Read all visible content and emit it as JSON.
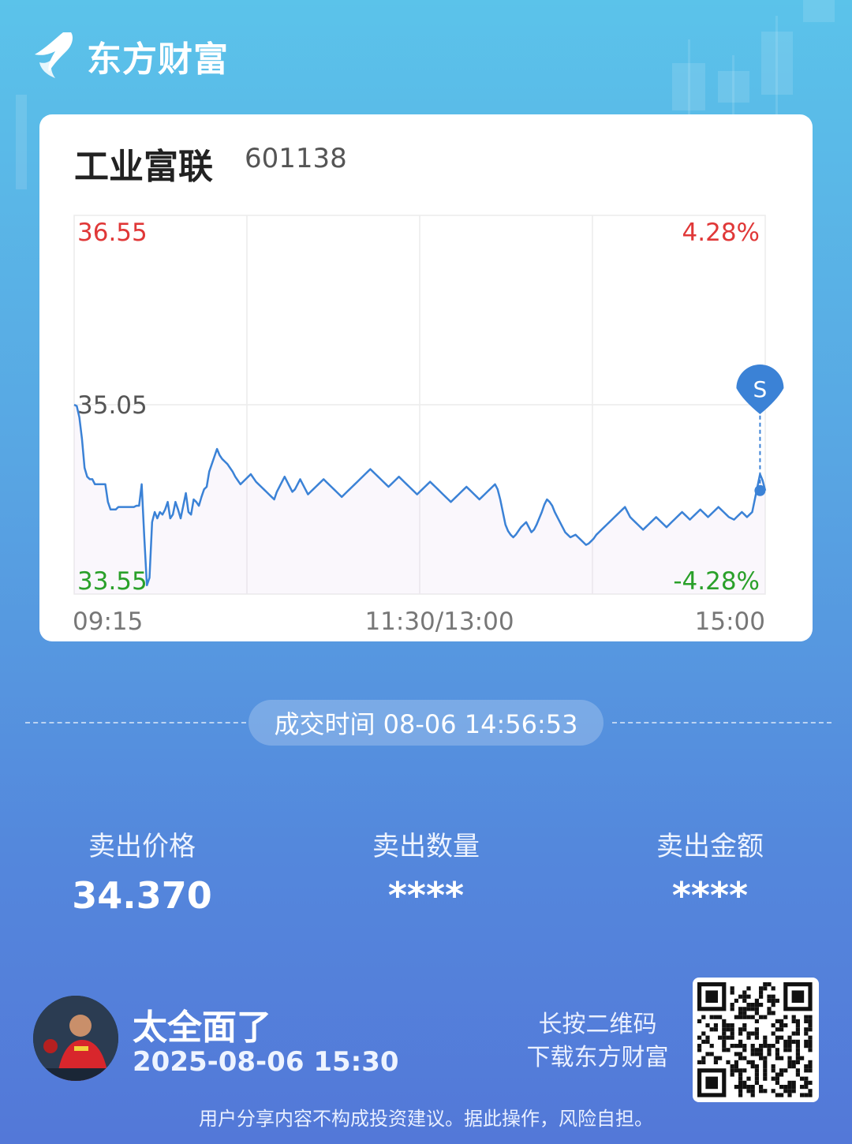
{
  "app": {
    "brand": "东方财富"
  },
  "stock": {
    "name": "工业富联",
    "code": "601138"
  },
  "chart_data": {
    "type": "line",
    "price_labels": {
      "high": "36.55",
      "mid": "35.05",
      "low": "33.55"
    },
    "pct_labels": {
      "high": "4.28%",
      "low": "-4.28%"
    },
    "x_labels": [
      "09:15",
      "11:30/13:00",
      "15:00"
    ],
    "ylim": [
      33.55,
      36.55
    ],
    "prev_close": 35.05,
    "marker": {
      "label": "S",
      "price": 34.37
    },
    "series": [
      {
        "values": [
          35.05,
          35.04,
          34.95,
          34.78,
          34.55,
          34.48,
          34.46,
          34.46,
          34.42,
          34.42,
          34.42,
          34.42,
          34.42,
          34.28,
          34.22,
          34.22,
          34.22,
          34.24,
          34.24,
          34.24,
          34.24,
          34.24,
          34.24,
          34.24,
          34.25,
          34.25,
          34.42,
          34.0,
          33.62,
          33.68,
          34.12,
          34.2,
          34.15,
          34.2,
          34.18,
          34.22,
          34.28,
          34.15,
          34.18,
          34.28,
          34.22,
          34.15,
          34.25,
          34.35,
          34.2,
          34.18,
          34.3,
          34.28,
          34.25,
          34.32,
          34.38,
          34.4,
          34.52,
          34.58,
          34.64,
          34.7,
          34.65,
          34.62,
          34.6,
          34.58,
          34.55,
          34.52,
          34.48,
          34.45,
          34.42,
          34.44,
          34.46,
          34.48,
          34.5,
          34.47,
          34.44,
          34.42,
          34.4,
          34.38,
          34.36,
          34.34,
          34.32,
          34.3,
          34.36,
          34.4,
          34.44,
          34.48,
          34.44,
          34.4,
          34.36,
          34.38,
          34.42,
          34.46,
          34.42,
          34.38,
          34.34,
          34.36,
          34.38,
          34.4,
          34.42,
          34.44,
          34.46,
          34.44,
          34.42,
          34.4,
          34.38,
          34.36,
          34.34,
          34.32,
          34.34,
          34.36,
          34.38,
          34.4,
          34.42,
          34.44,
          34.46,
          34.48,
          34.5,
          34.52,
          34.54,
          34.52,
          34.5,
          34.48,
          34.46,
          34.44,
          34.42,
          34.4,
          34.42,
          34.44,
          34.46,
          34.48,
          34.46,
          34.44,
          34.42,
          34.4,
          34.38,
          34.36,
          34.34,
          34.36,
          34.38,
          34.4,
          34.42,
          34.44,
          34.42,
          34.4,
          34.38,
          34.36,
          34.34,
          34.32,
          34.3,
          34.28,
          34.3,
          34.32,
          34.34,
          34.36,
          34.38,
          34.4,
          34.38,
          34.36,
          34.34,
          34.32,
          34.3,
          34.32,
          34.34,
          34.36,
          34.38,
          34.4,
          34.42,
          34.38,
          34.3,
          34.2,
          34.1,
          34.05,
          34.02,
          34.0,
          34.02,
          34.05,
          34.08,
          34.1,
          34.12,
          34.08,
          34.04,
          34.06,
          34.1,
          34.15,
          34.2,
          34.26,
          34.3,
          34.28,
          34.25,
          34.2,
          34.16,
          34.12,
          34.08,
          34.04,
          34.02,
          34.0,
          34.01,
          34.02,
          34.0,
          33.98,
          33.96,
          33.94,
          33.95,
          33.97,
          33.99,
          34.02,
          34.04,
          34.06,
          34.08,
          34.1,
          34.12,
          34.14,
          34.16,
          34.18,
          34.2,
          34.22,
          34.24,
          34.2,
          34.16,
          34.14,
          34.12,
          34.1,
          34.08,
          34.06,
          34.08,
          34.1,
          34.12,
          34.14,
          34.16,
          34.14,
          34.12,
          34.1,
          34.08,
          34.1,
          34.12,
          34.14,
          34.16,
          34.18,
          34.2,
          34.18,
          34.16,
          34.14,
          34.16,
          34.18,
          34.2,
          34.22,
          34.2,
          34.18,
          34.16,
          34.18,
          34.2,
          34.22,
          34.24,
          34.22,
          34.2,
          34.18,
          34.16,
          34.15,
          34.14,
          34.16,
          34.18,
          34.2,
          34.18,
          34.16,
          34.18,
          34.2,
          34.3,
          34.4,
          34.5,
          34.45,
          34.37
        ]
      }
    ]
  },
  "trade": {
    "time_label": "成交时间 08-06 14:56:53"
  },
  "stats": [
    {
      "label": "卖出价格",
      "value": "34.370"
    },
    {
      "label": "卖出数量",
      "value": "****"
    },
    {
      "label": "卖出金额",
      "value": "****"
    }
  ],
  "user": {
    "name": "太全面了",
    "time": "2025-08-06 15:30"
  },
  "qr_hint": {
    "line1": "长按二维码",
    "line2": "下载东方财富"
  },
  "disclaimer": "用户分享内容不构成投资建议。据此操作，风险自担。",
  "colors": {
    "up": "#e03838",
    "down": "#2aa02a",
    "line": "#3b82d6",
    "neutral": "#555555"
  }
}
